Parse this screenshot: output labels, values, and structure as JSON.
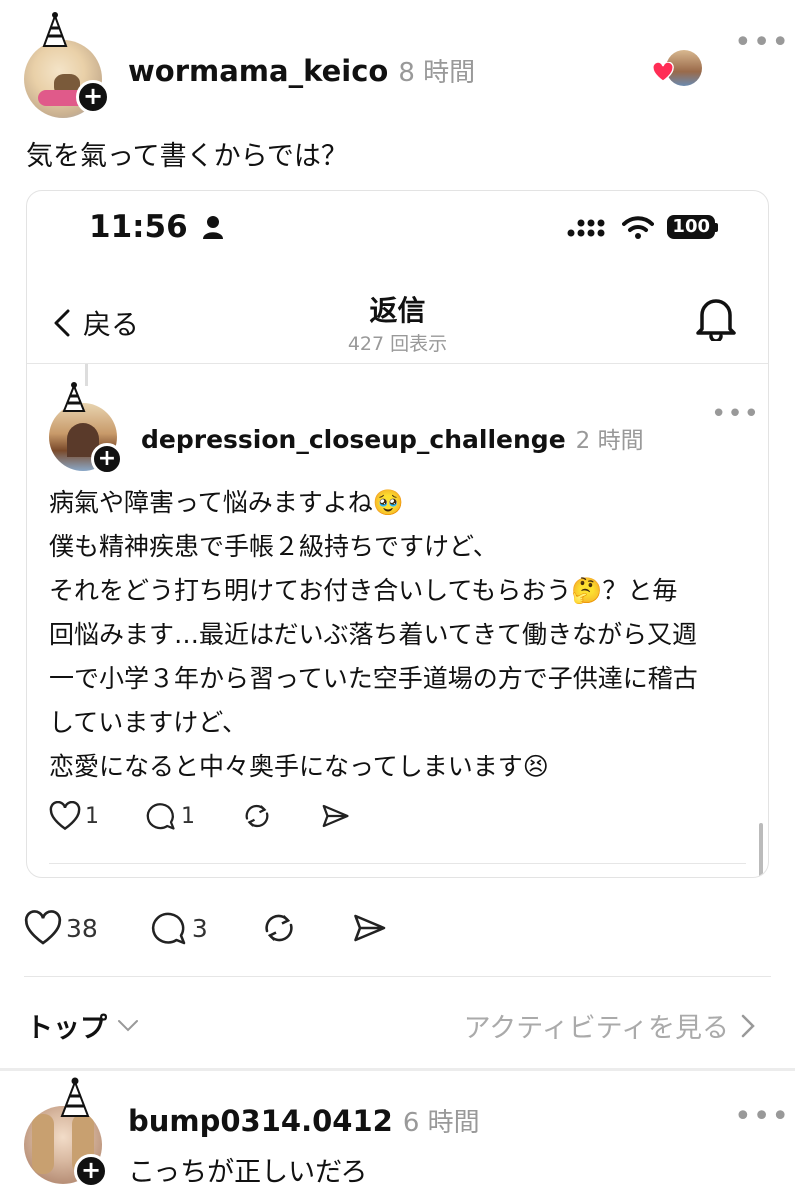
{
  "main_post": {
    "username": "wormama_keico",
    "time": "8 時間",
    "text": "気を氣って書くからでは？"
  },
  "screenshot": {
    "status_time": "11:56",
    "battery": "100",
    "nav_back": "戻る",
    "nav_title": "返信",
    "nav_subtitle": "427 回表示",
    "inner_post": {
      "username": "depression_closeup_challenge",
      "time": "2 時間",
      "lines": [
        "病氣や障害って悩みますよね🥹",
        "僕も精神疾患で手帳２級持ちですけど、",
        "それをどう打ち明けてお付き合いしてもらおう🤔？と毎",
        "回悩みます…最近はだいぶ落ち着いてきて働きながら又週",
        "一で小学３年から習っていた空手道場の方で子供達に稽古",
        "していますけど、",
        "恋愛になると中々奥手になってしまいます😣"
      ],
      "likes": "1",
      "replies": "1"
    }
  },
  "main_actions": {
    "likes": "38",
    "replies": "3"
  },
  "sort": {
    "label": "トップ",
    "activity_link": "アクティビティを見る"
  },
  "reply": {
    "username": "bump0314.0412",
    "time": "6 時間",
    "text": "こっちが正しいだろ"
  },
  "colors": {
    "like_heart": "#ff2d55",
    "muted": "#999999"
  },
  "icons": [
    "plus-icon",
    "heart-icon",
    "comment-icon",
    "repost-icon",
    "share-icon",
    "bell-icon",
    "chevron-left-icon",
    "chevron-down-icon",
    "chevron-right-icon",
    "person-icon",
    "signal-icon",
    "wifi-icon",
    "battery-icon",
    "more-icon"
  ]
}
